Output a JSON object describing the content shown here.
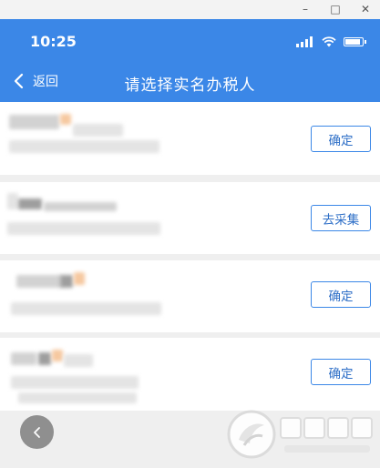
{
  "window": {
    "minimize_glyph": "–",
    "maximize_glyph": "□",
    "close_glyph": "✕"
  },
  "status_bar": {
    "time": "10:25",
    "icons": [
      "signal-icon",
      "wifi-icon",
      "battery-icon"
    ],
    "background": "#3b87e7"
  },
  "nav": {
    "back_label": "返回",
    "title": "请选择实名办税人"
  },
  "taxpayers": [
    {
      "action_label": "确定"
    },
    {
      "action_label": "去采集"
    },
    {
      "action_label": "确定"
    },
    {
      "action_label": "确定"
    }
  ],
  "colors": {
    "accent": "#3b87e7",
    "button_text": "#2e6fc7",
    "page_background": "#efefef"
  },
  "watermark": {
    "logo": "watermark-logo"
  }
}
